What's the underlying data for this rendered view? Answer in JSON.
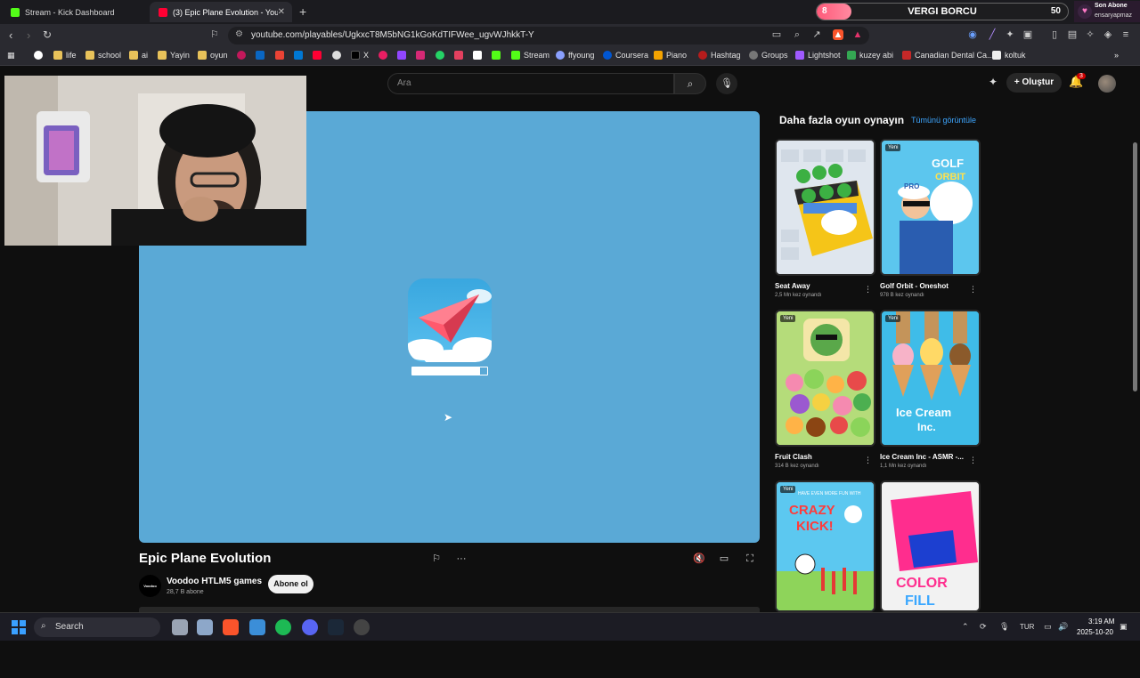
{
  "tabs": [
    {
      "title": "Stream - Kick Dashboard",
      "icon": "kick-icon"
    },
    {
      "title": "(3) Epic Plane Evolution - YouTube",
      "icon": "youtube-icon"
    }
  ],
  "new_tab_symbol": "+",
  "overlay": {
    "goal_start": "8",
    "goal_title": "VERGI BORCU",
    "goal_end": "50",
    "goal_progress": 0.14,
    "last_sub_label": "Son Abone",
    "last_sub_name": "ensaryapmaz"
  },
  "address_bar": {
    "url": "youtube.com/playables/UgkxcT8M5bNG1kGoKdTIFWee_ugvWJhkkT-Y"
  },
  "bookmarks": [
    {
      "label": "",
      "icon": "google-icon"
    },
    {
      "label": "life",
      "icon": "folder-icon"
    },
    {
      "label": "school",
      "icon": "folder-icon"
    },
    {
      "label": "ai",
      "icon": "folder-icon"
    },
    {
      "label": "Yayin",
      "icon": "folder-icon"
    },
    {
      "label": "oyun",
      "icon": "folder-icon"
    },
    {
      "label": "X",
      "icon": "x-icon"
    },
    {
      "label": "Stream",
      "icon": "kick-icon"
    },
    {
      "label": "ffyoung",
      "icon": "link-icon"
    },
    {
      "label": "Coursera",
      "icon": "coursera-icon"
    },
    {
      "label": "Piano",
      "icon": "piano-icon"
    },
    {
      "label": "Hashtag",
      "icon": "hashtag-icon"
    },
    {
      "label": "Groups",
      "icon": "groups-icon"
    },
    {
      "label": "Lightshot",
      "icon": "lightshot-icon"
    },
    {
      "label": "kuzey abi",
      "icon": "drive-icon"
    },
    {
      "label": "Canadian Dental Ca...",
      "icon": "dental-icon"
    },
    {
      "label": "koltuk",
      "icon": "bookmark-icon"
    }
  ],
  "youtube": {
    "search_placeholder": "Ara",
    "create_label": "Oluştur",
    "notification_count": "3"
  },
  "game": {
    "title": "Epic Plane Evolution",
    "load_progress": 0.9,
    "channel_logo_text": "Voodoo",
    "channel_name": "Voodoo HTLM5 games",
    "subscribers": "28,7 B abone",
    "subscribe_label": "Abone ol"
  },
  "sidebar": {
    "title": "Daha fazla oyun oynayın",
    "view_all": "Tümünü görüntüle",
    "new_badge": "Yeni",
    "games": [
      {
        "title": "Seat Away",
        "plays": "2,5 Mn kez oynandı",
        "is_new": false
      },
      {
        "title": "Golf Orbit - Oneshot",
        "plays": "978 B kez oynandı",
        "is_new": true,
        "art_text_1": "GOLF",
        "art_text_2": "ORBIT",
        "art_text_3": "PRO"
      },
      {
        "title": "Fruit Clash",
        "plays": "314 B kez oynandı",
        "is_new": true
      },
      {
        "title": "Ice Cream Inc - ASMR -...",
        "plays": "1,1 Mn kez oynandı",
        "is_new": true,
        "art_text_1": "Ice Cream",
        "art_text_2": "Inc."
      },
      {
        "title": "",
        "plays": "",
        "is_new": true,
        "art_text_1": "CRAZY",
        "art_text_2": "KICK!",
        "art_text_3": "HAVE EVEN MORE FUN WITH"
      },
      {
        "title": "",
        "plays": "",
        "is_new": false,
        "art_text_1": "COLOR",
        "art_text_2": "FILL"
      }
    ]
  },
  "taskbar": {
    "search_label": "Search",
    "language": "TUR",
    "time": "3:19 AM",
    "date": "2025-10-20"
  }
}
